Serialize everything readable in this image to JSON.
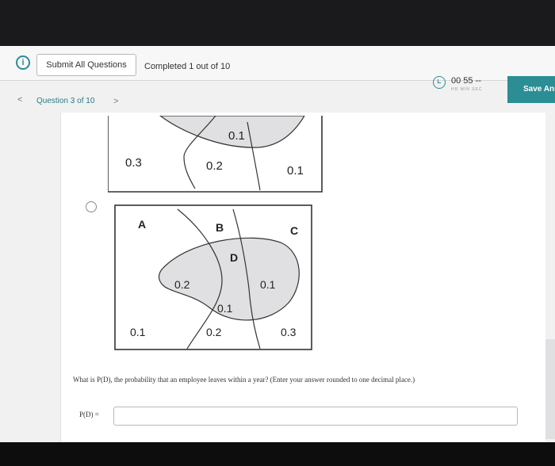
{
  "header": {
    "submit_all_label": "Submit All Questions",
    "completed_text": "Completed 1 out of 10",
    "timer_text": "00  55  --",
    "timer_units": "HR   MIN   SEC",
    "save_label": "Save Ans"
  },
  "nav": {
    "prev": "<",
    "question_label": "Question 3 of 10",
    "next": ">"
  },
  "venn_top": {
    "labels": [
      "0.1",
      "0.3",
      "0.2",
      "0.1"
    ]
  },
  "venn_main": {
    "set_labels": [
      "A",
      "B",
      "C",
      "D"
    ],
    "values": [
      "0.2",
      "0.1",
      "0.1",
      "0.1",
      "0.2",
      "0.3"
    ]
  },
  "question": {
    "text": "What is P(D), the probability that an employee leaves within a year? (Enter your answer rounded to one decimal place.)",
    "answer_label": "P(D) =",
    "answer_value": ""
  },
  "colors": {
    "accent": "#2b8e95",
    "shaded_region": "#e0e0e2"
  }
}
